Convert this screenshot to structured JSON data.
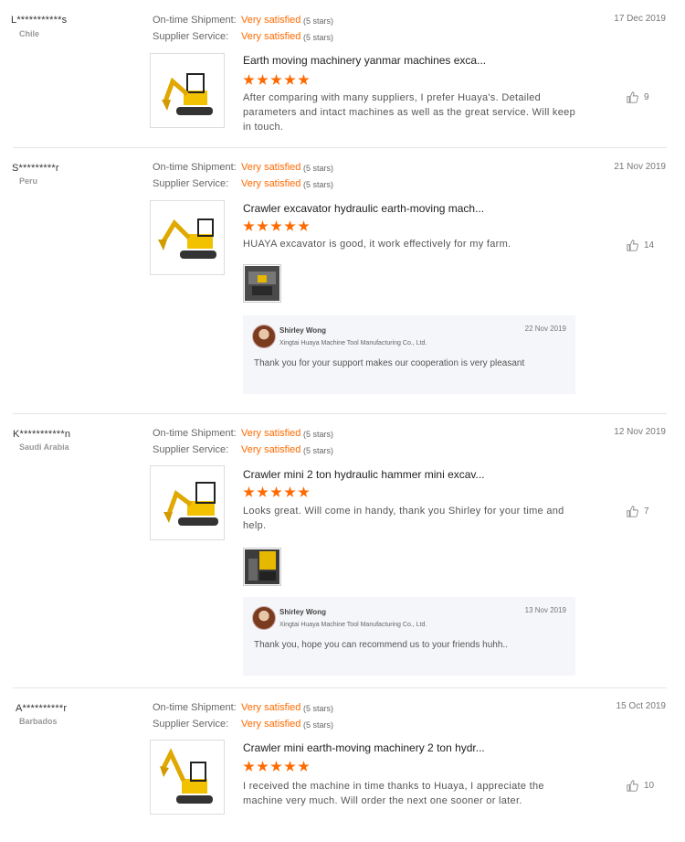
{
  "labels": {
    "ontime": "On-time Shipment:",
    "supplier": "Supplier Service:"
  },
  "colors": {
    "accent": "#ff6a00",
    "separator": "#e6e6e6"
  },
  "reviews": [
    {
      "buyer": "L***********s",
      "country": "Chile",
      "ontime_value": "Very satisfied",
      "ontime_stars": "(5 stars)",
      "supplier_value": "Very satisfied",
      "supplier_stars": "(5 stars)",
      "date": "17 Dec 2019",
      "product_title": "Earth moving machinery yanmar machines exca...",
      "rating": 5,
      "comment": "After comparing with many suppliers, I prefer Huaya's. Detailed parameters and intact machines as well as the great service. Will keep in touch.",
      "likes": "9"
    },
    {
      "buyer": "S*********r",
      "country": "Peru",
      "ontime_value": "Very satisfied",
      "ontime_stars": "(5 stars)",
      "supplier_value": "Very satisfied",
      "supplier_stars": "(5 stars)",
      "date": "21 Nov 2019",
      "product_title": "Crawler excavator hydraulic earth-moving mach...",
      "rating": 5,
      "comment": "HUAYA excavator is good, it work effectively for my farm.",
      "likes": "14",
      "reply": {
        "name": "Shirley Wong",
        "company": "Xingtai Huaya Machine Tool Manufacturing Co., Ltd.",
        "date": "22 Nov 2019",
        "text": "Thank you for your support makes our cooperation is very pleasant"
      }
    },
    {
      "buyer": "K***********n",
      "country": "Saudi Arabia",
      "ontime_value": "Very satisfied",
      "ontime_stars": "(5 stars)",
      "supplier_value": "Very satisfied",
      "supplier_stars": "(5 stars)",
      "date": "12 Nov 2019",
      "product_title": "Crawler mini 2 ton hydraulic hammer mini excav...",
      "rating": 5,
      "comment": "Looks great. Will come in handy, thank you Shirley for your time and help.",
      "likes": "7",
      "reply": {
        "name": "Shirley Wong",
        "company": "Xingtai Huaya Machine Tool Manufacturing Co., Ltd.",
        "date": "13 Nov 2019",
        "text": "Thank you, hope you can recommend us to your friends huhh.."
      }
    },
    {
      "buyer": "A**********r",
      "country": "Barbados",
      "ontime_value": "Very satisfied",
      "ontime_stars": "(5 stars)",
      "supplier_value": "Very satisfied",
      "supplier_stars": "(5 stars)",
      "date": "15 Oct 2019",
      "product_title": "Crawler mini earth-moving machinery 2 ton hydr...",
      "rating": 5,
      "comment": "I received the machine in time thanks to Huaya, I appreciate the machine very much. Will order the next one sooner or later.",
      "likes": "10"
    }
  ]
}
